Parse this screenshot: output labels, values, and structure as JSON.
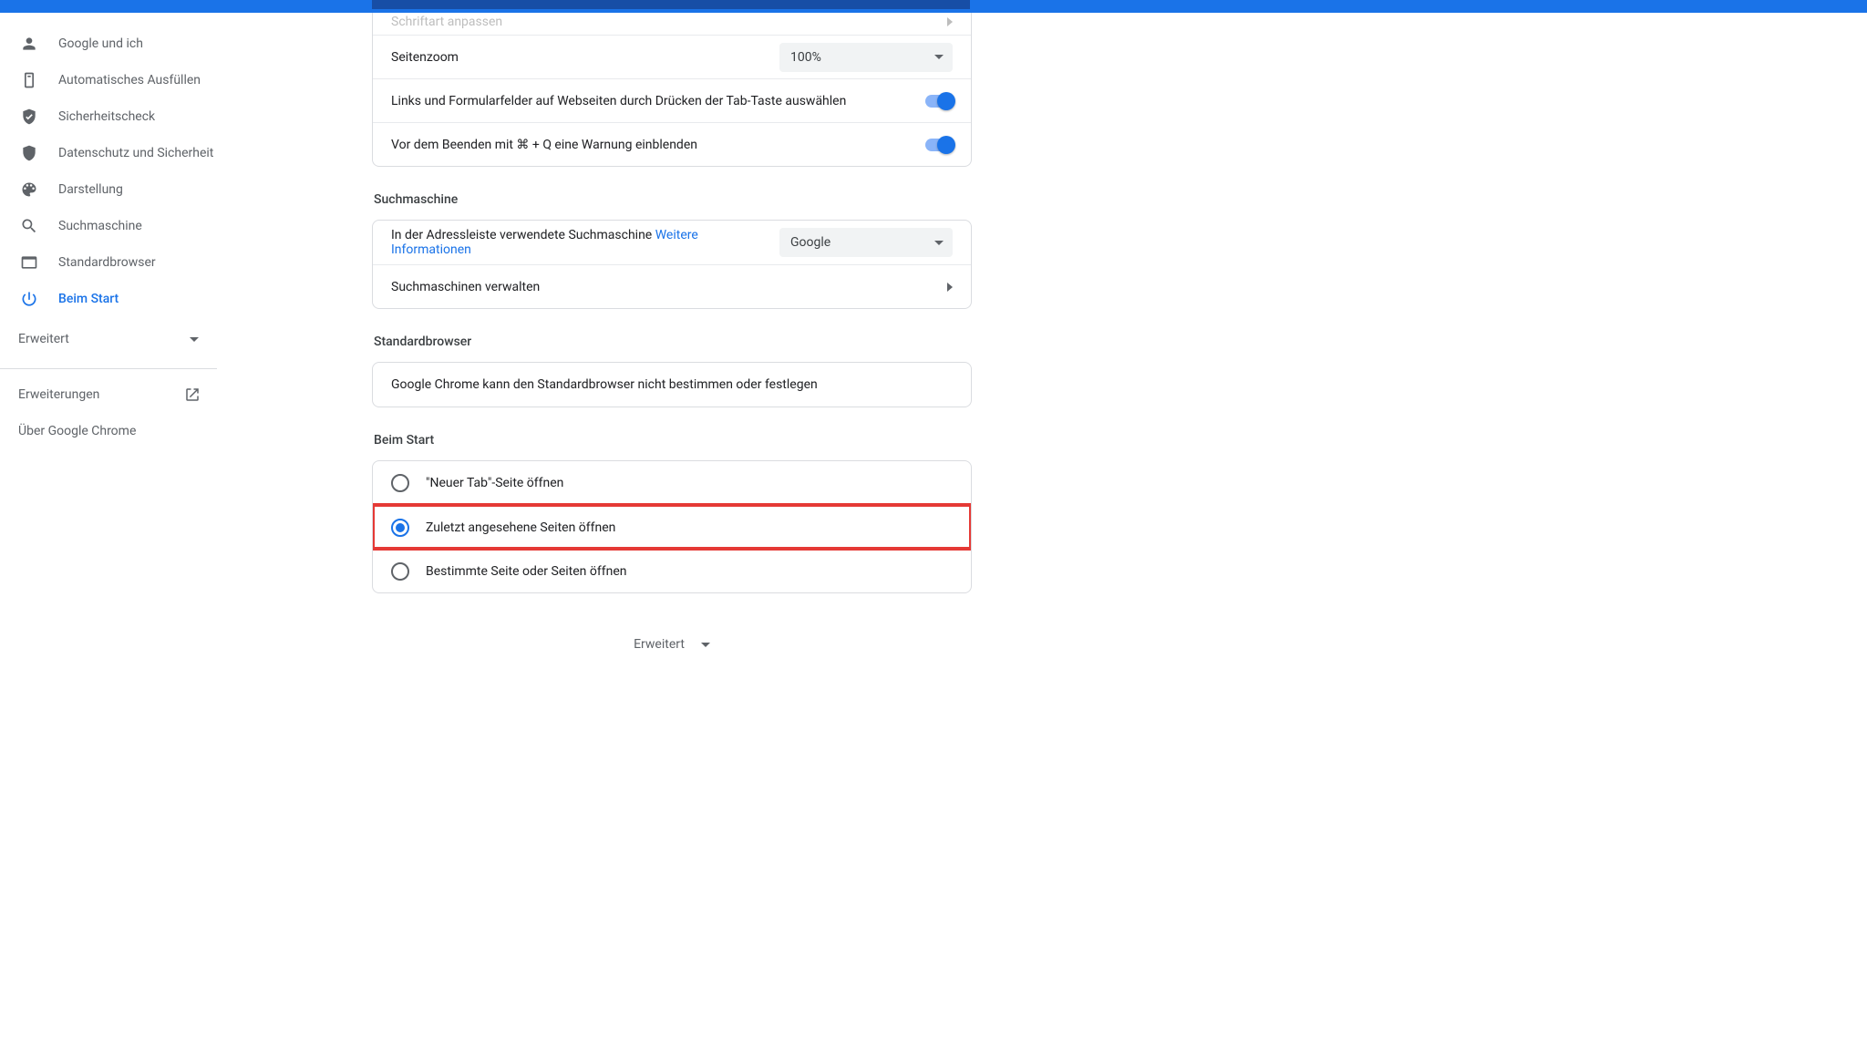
{
  "sidebar": {
    "items": [
      {
        "label": "Google und ich"
      },
      {
        "label": "Automatisches Ausfüllen"
      },
      {
        "label": "Sicherheitscheck"
      },
      {
        "label": "Datenschutz und Sicherheit"
      },
      {
        "label": "Darstellung"
      },
      {
        "label": "Suchmaschine"
      },
      {
        "label": "Standardbrowser"
      },
      {
        "label": "Beim Start"
      }
    ],
    "advanced": "Erweitert",
    "extensions": "Erweiterungen",
    "about": "Über Google Chrome"
  },
  "appearance": {
    "font_row": "Schriftart anpassen",
    "zoom_label": "Seitenzoom",
    "zoom_value": "100%",
    "tab_select": "Links und Formularfelder auf Webseiten durch Drücken der Tab-Taste auswählen",
    "warn_quit": "Vor dem Beenden mit ⌘ + Q eine Warnung einblenden"
  },
  "search": {
    "section": "Suchmaschine",
    "adressbar_label": "In der Adressleiste verwendete Suchmaschine ",
    "more_info": "Weitere Informationen",
    "engine_value": "Google",
    "manage": "Suchmaschinen verwalten"
  },
  "default_browser": {
    "section": "Standardbrowser",
    "text": "Google Chrome kann den Standardbrowser nicht bestimmen oder festlegen"
  },
  "startup": {
    "section": "Beim Start",
    "opt_newtab": "\"Neuer Tab\"-Seite öffnen",
    "opt_continue": "Zuletzt angesehene Seiten öffnen",
    "opt_specific": "Bestimmte Seite oder Seiten öffnen"
  },
  "bottom_advanced": "Erweitert"
}
